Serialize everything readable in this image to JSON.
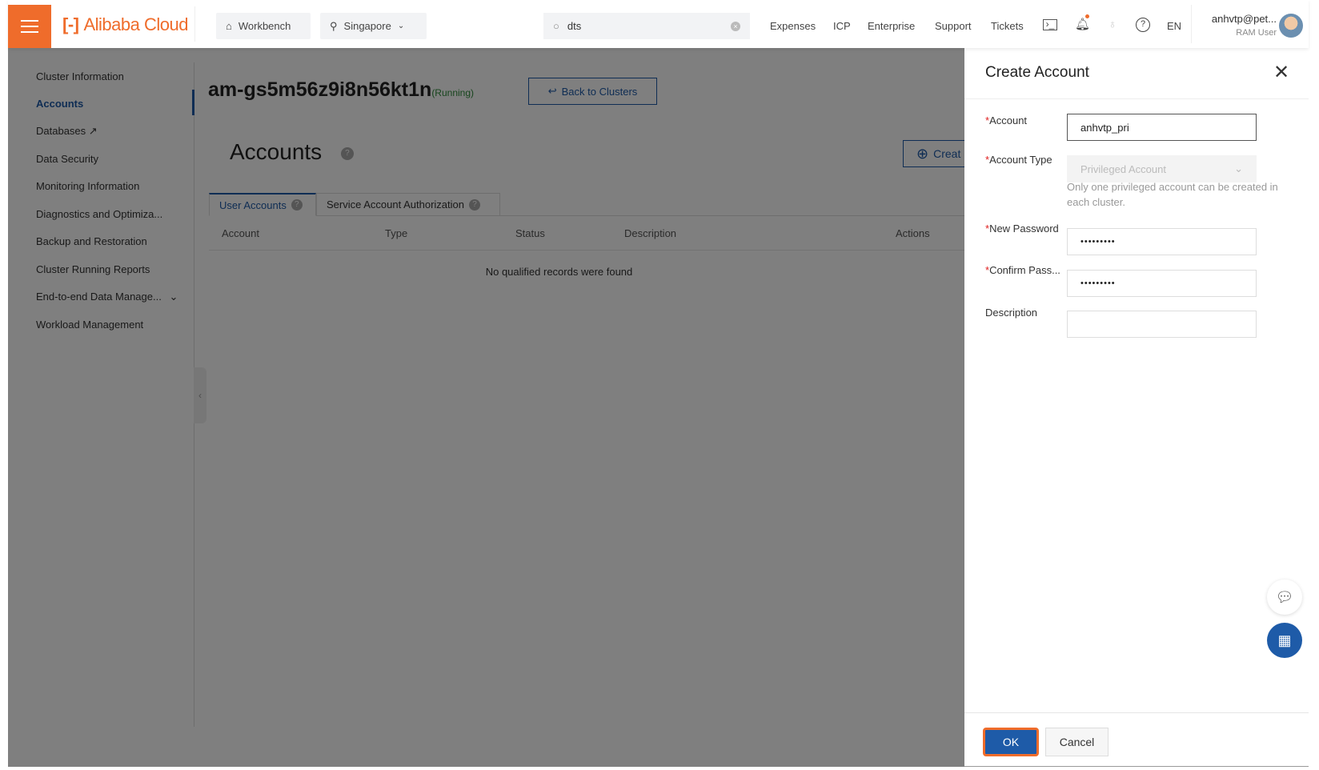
{
  "header": {
    "brand": "Alibaba Cloud",
    "workbench": "Workbench",
    "region": "Singapore",
    "search_value": "dts",
    "nav": [
      "Expenses",
      "ICP",
      "Enterprise",
      "Support",
      "Tickets"
    ],
    "language": "EN",
    "user_name": "anhvtp@pet...",
    "user_role": "RAM User"
  },
  "sidebar": {
    "items": [
      {
        "label": "Cluster Information"
      },
      {
        "label": "Accounts",
        "active": true
      },
      {
        "label": "Databases"
      },
      {
        "label": "Data Security"
      },
      {
        "label": "Monitoring Information"
      },
      {
        "label": "Diagnostics and Optimiza..."
      },
      {
        "label": "Backup and Restoration"
      },
      {
        "label": "Cluster Running Reports"
      },
      {
        "label": "End-to-end Data Manage..."
      },
      {
        "label": "Workload Management"
      }
    ]
  },
  "main": {
    "cluster_id": "am-gs5m56z9i8n56kt1n",
    "cluster_status": "(Running)",
    "back_label": "Back to Clusters",
    "heading": "Accounts",
    "create_label": "Creat",
    "tabs": [
      {
        "label": "User Accounts",
        "active": true
      },
      {
        "label": "Service Account Authorization"
      }
    ],
    "columns": [
      "Account",
      "Type",
      "Status",
      "Description",
      "Actions"
    ],
    "empty_text": "No qualified records were found"
  },
  "drawer": {
    "title": "Create Account",
    "fields": {
      "account": {
        "label": "Account",
        "required": true,
        "value": "anhvtp_pri"
      },
      "account_type": {
        "label": "Account Type",
        "required": true,
        "value": "Privileged Account",
        "help": "Only one privileged account can be created in each cluster."
      },
      "new_password": {
        "label": "New Password",
        "required": true,
        "value": "•••••••••"
      },
      "confirm_password": {
        "label": "Confirm Pass...",
        "required": true,
        "value": "•••••••••"
      },
      "description": {
        "label": "Description",
        "required": false,
        "value": ""
      }
    },
    "required_mark": "*",
    "ok_label": "OK",
    "cancel_label": "Cancel"
  },
  "colors": {
    "brand": "#ef6c2b",
    "primary": "#1e5ba8",
    "running": "#2e8b3a",
    "required": "#e02020"
  }
}
